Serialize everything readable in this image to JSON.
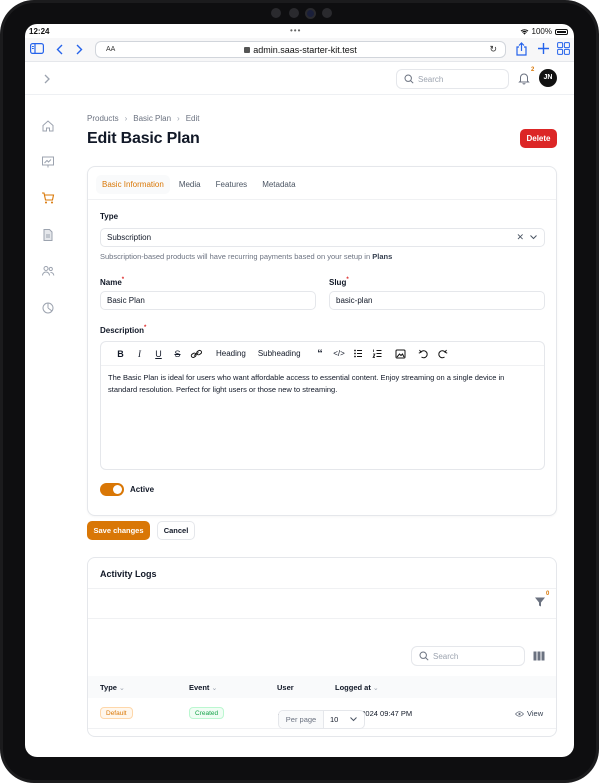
{
  "status_bar": {
    "time": "12:24",
    "battery": "100%"
  },
  "browser": {
    "aa": "AA",
    "url": "admin.saas-starter-kit.test"
  },
  "topnav": {
    "search_placeholder": "Search",
    "notification_count": "2",
    "avatar_initials": "JN"
  },
  "breadcrumb": [
    "Products",
    "Basic Plan",
    "Edit"
  ],
  "page_title": "Edit Basic Plan",
  "delete_label": "Delete",
  "tabs": [
    "Basic Information",
    "Media",
    "Features",
    "Metadata"
  ],
  "form": {
    "type_label": "Type",
    "type_value": "Subscription",
    "type_hint_prefix": "Subscription-based products will have recurring payments based on your setup in ",
    "type_hint_link": "Plans",
    "name_label": "Name",
    "name_value": "Basic Plan",
    "slug_label": "Slug",
    "slug_value": "basic-plan",
    "description_label": "Description",
    "toolbar_heading": "Heading",
    "toolbar_subheading": "Subheading",
    "description_value": "The Basic Plan is ideal for users who want affordable access to essential content. Enjoy streaming on a single device in standard resolution. Perfect for light users or those new to streaming.",
    "active_label": "Active",
    "active": true
  },
  "actions": {
    "save_label": "Save changes",
    "cancel_label": "Cancel"
  },
  "logs": {
    "title": "Activity Logs",
    "filter_count": "0",
    "search_placeholder": "Search",
    "columns": [
      "Type",
      "Event",
      "User",
      "Logged at"
    ],
    "rows": [
      {
        "type": "Default",
        "event": "Created",
        "user": "—",
        "logged_at": "Oct 15, 2024 09:47 PM",
        "action": "View"
      }
    ],
    "per_page_label": "Per page",
    "per_page_value": "10"
  },
  "colors": {
    "accent": "#d97706",
    "danger": "#dc2626",
    "success": "#16a34a"
  }
}
